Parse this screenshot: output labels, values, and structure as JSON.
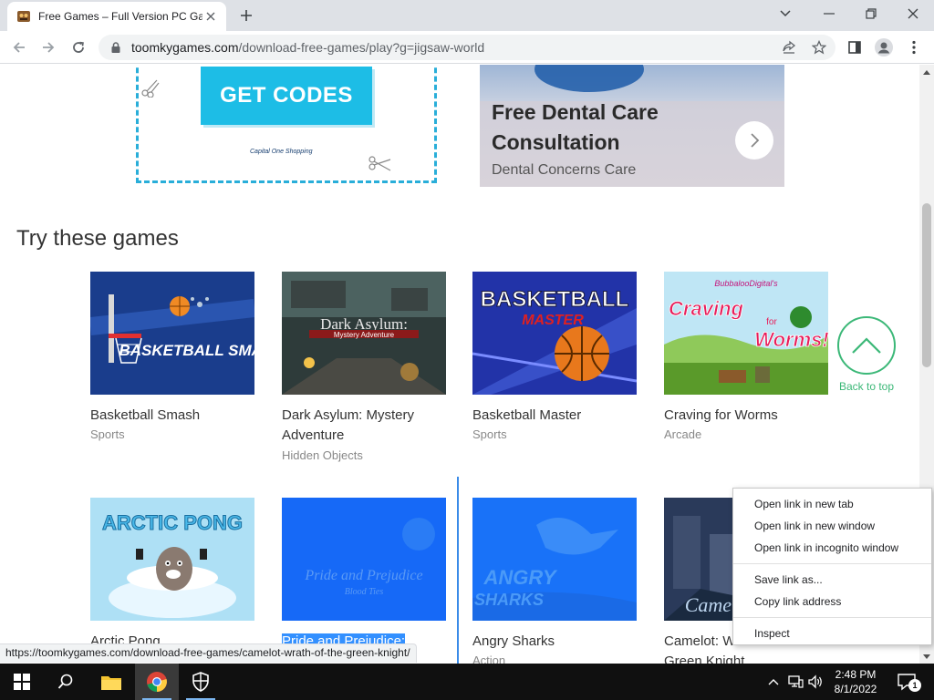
{
  "browser": {
    "tab_title": "Free Games – Full Version PC Games",
    "url_domain": "toomkygames.com",
    "url_path": "/download-free-games/play?g=jigsaw-world"
  },
  "ads": {
    "coupon_button": "GET CODES",
    "coupon_logo": "Capital One Shopping",
    "dental_title": "Free Dental Care Consultation",
    "dental_subtitle": "Dental Concerns Care"
  },
  "section_title": "Try these games",
  "games": [
    {
      "title": "Basketball Smash",
      "category": "Sports",
      "art": "BASKETBALL SMASH"
    },
    {
      "title": "Dark Asylum: Mystery Adventure",
      "category": "Hidden Objects",
      "art": "Dark Asylum:",
      "art2": "Mystery Adventure"
    },
    {
      "title": "Basketball Master",
      "category": "Sports",
      "art": "BASKETBALL",
      "art2": "MASTER"
    },
    {
      "title": "Craving for Worms",
      "category": "Arcade",
      "art_top": "BubbalooDigital's",
      "art": "Craving",
      "art2": "for",
      "art3": "Worms!"
    },
    {
      "title": "Arctic Pong",
      "category": "",
      "art": "ARCTIC PONG"
    },
    {
      "title": "Pride and Prejudice:",
      "category": "",
      "art": "Pride and Prejudice",
      "art2": "Blood Ties"
    },
    {
      "title": "Angry Sharks",
      "category": "Action",
      "art": "ANGRY",
      "art2": "SHARKS"
    },
    {
      "title": "Camelot: Wrath of the Green Knight",
      "title_visible": "Camelot: W",
      "title_line2": "Green Knight",
      "category": "",
      "art": "Camelot"
    }
  ],
  "back_to_top": "Back to top",
  "status_url": "https://toomkygames.com/download-free-games/camelot-wrath-of-the-green-knight/",
  "context_menu": {
    "group1": [
      "Open link in new tab",
      "Open link in new window",
      "Open link in incognito window"
    ],
    "group2": [
      "Save link as...",
      "Copy link address"
    ],
    "group3": [
      "Inspect"
    ]
  },
  "taskbar": {
    "time": "2:48 PM",
    "date": "8/1/2022",
    "notifications": "1"
  }
}
